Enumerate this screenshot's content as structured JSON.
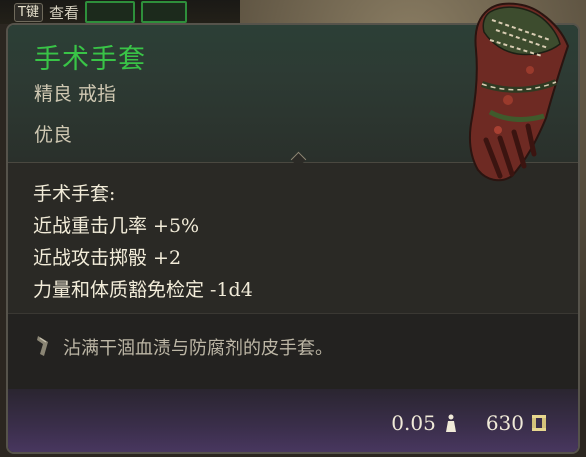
{
  "hotbar": {
    "hotkey": "T键",
    "label": "查看"
  },
  "item": {
    "name": "手术手套",
    "subtitle": "精良 戒指",
    "rarity": "优良",
    "icon": "surgical-gloves-icon"
  },
  "stats": {
    "heading": "手术手套:",
    "lines": [
      "近战重击几率 +5%",
      "近战攻击掷骰 +2",
      "力量和体质豁免检定 -1d4"
    ]
  },
  "description": {
    "icon": "quill-icon",
    "text": "沾满干涸血渍与防腐剂的皮手套。"
  },
  "footer": {
    "weight": "0.05",
    "weight_icon": "weight-icon",
    "value": "630",
    "value_icon": "gold-icon"
  },
  "colors": {
    "title": "#39c447",
    "body_text": "#f2ecd9",
    "muted_text": "#cfc8b2",
    "footer_gradient_end": "#4a3862"
  }
}
